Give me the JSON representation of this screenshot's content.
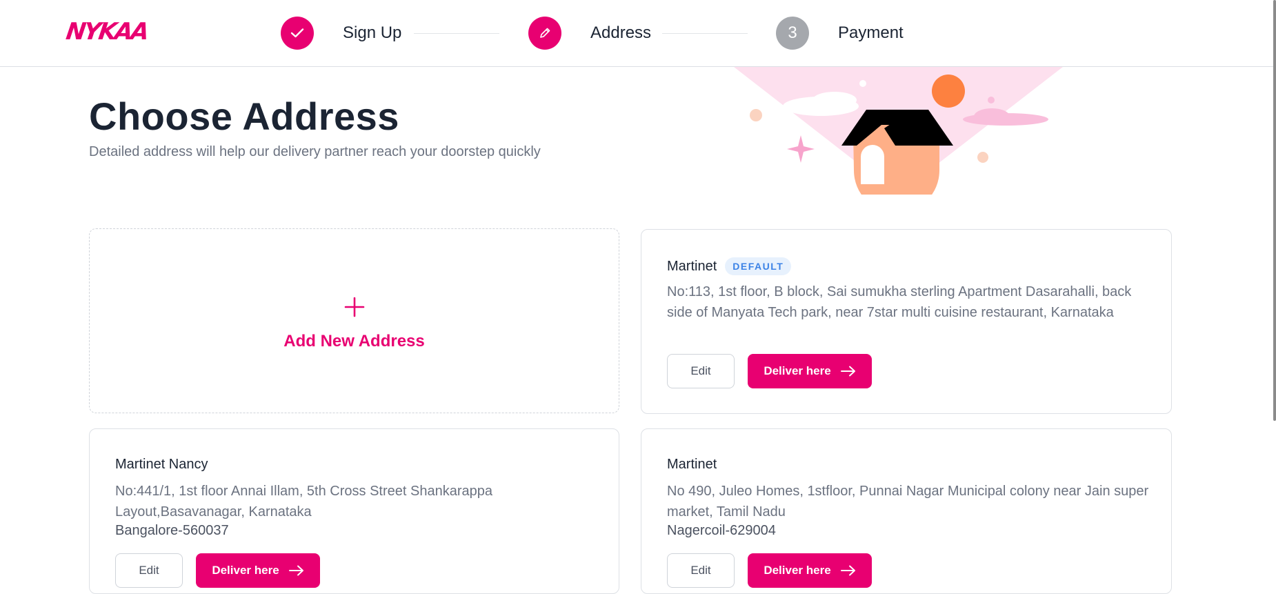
{
  "brand": {
    "logo_text": "NYKAA",
    "accent": "#e80071"
  },
  "steps": [
    {
      "label": "Sign Up",
      "state": "done",
      "icon": "check-icon"
    },
    {
      "label": "Address",
      "state": "active",
      "icon": "pencil-icon"
    },
    {
      "label": "Payment",
      "state": "pending",
      "number": "3"
    }
  ],
  "page": {
    "title": "Choose Address",
    "subtitle": "Detailed address will help our delivery partner reach your doorstep quickly"
  },
  "add_card": {
    "label": "Add New Address",
    "icon": "plus-icon"
  },
  "addresses": [
    {
      "name": "Martinet",
      "badge": "DEFAULT",
      "address": "No:113, 1st floor, B block, Sai sumukha sterling Apartment Dasarahalli, back side of Manyata Tech park, near 7star multi cuisine restaurant, Karnataka",
      "city": "",
      "edit_label": "Edit",
      "deliver_label": "Deliver here"
    },
    {
      "name": "Martinet Nancy",
      "badge": "",
      "address": "No:441/1, 1st floor Annai Illam, 5th Cross Street Shankarappa Layout,Basavanagar, Karnataka",
      "city": "Bangalore-560037",
      "edit_label": "Edit",
      "deliver_label": "Deliver here"
    },
    {
      "name": "Martinet",
      "badge": "",
      "address": "No 490, Juleo Homes, 1stfloor, Punnai Nagar Municipal colony near Jain super market, Tamil Nadu",
      "city": "Nagercoil-629004",
      "edit_label": "Edit",
      "deliver_label": "Deliver here"
    }
  ]
}
